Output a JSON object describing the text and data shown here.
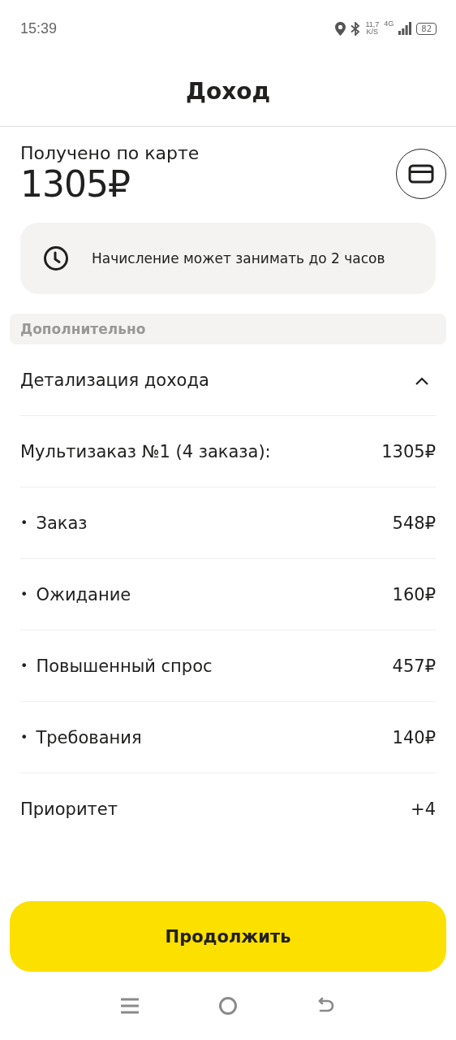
{
  "status_bar": {
    "time": "15:39",
    "speed": "11,7",
    "speed_unit": "K/S",
    "network": "4G",
    "battery": "82"
  },
  "header": {
    "title": "Доход"
  },
  "summary": {
    "label": "Получено по карте",
    "amount": "1305₽"
  },
  "notice": {
    "text": "Начисление может занимать до 2 часов"
  },
  "section": {
    "title": "Дополнительно"
  },
  "details": {
    "title": "Детализация дохода",
    "expanded": true,
    "rows": [
      {
        "kind": "main",
        "label": "Мультизаказ №1 (4 заказа):",
        "value": "1305₽"
      },
      {
        "kind": "sub",
        "marker": "•",
        "label": "Заказ",
        "value": "548₽"
      },
      {
        "kind": "sub",
        "marker": "•",
        "label": "Ожидание",
        "value": "160₽"
      },
      {
        "kind": "sub",
        "marker": "•",
        "label": "Повышенный спрос",
        "value": "457₽"
      },
      {
        "kind": "sub",
        "marker": "•",
        "label": "Требования",
        "value": "140₽"
      },
      {
        "kind": "main",
        "label": "Приоритет",
        "value": "+4"
      }
    ]
  },
  "primary_button": {
    "label": "Продолжить"
  }
}
